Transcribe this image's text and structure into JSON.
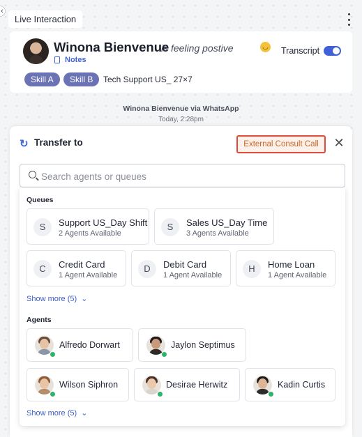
{
  "header": {
    "tab_label": "Live Interaction"
  },
  "customer": {
    "name": "Winona Bienvenue",
    "sentiment": "is feeling postive",
    "notes_label": "Notes",
    "transcript_label": "Transcript",
    "transcript_on": true,
    "skills": [
      "Skill A",
      "Skill B"
    ],
    "queue_info": "Tech Support US_ 27×7"
  },
  "conversation": {
    "source": "Winona Bienvenue via WhatsApp",
    "time": "Today, 2:28pm"
  },
  "transfer": {
    "title": "Transfer to",
    "external_consult_label": "External Consult Call",
    "search_placeholder": "Search agents or queues",
    "queues_label": "Queues",
    "queues": [
      {
        "letter": "S",
        "name": "Support US_Day Shift",
        "availability": "2 Agents Available"
      },
      {
        "letter": "S",
        "name": "Sales US_Day Time",
        "availability": "3 Agents Available"
      },
      {
        "letter": "C",
        "name": "Credit Card",
        "availability": "1 Agent Available"
      },
      {
        "letter": "D",
        "name": "Debit Card",
        "availability": "1 Agent Available"
      },
      {
        "letter": "H",
        "name": "Home Loan",
        "availability": "1 Agent Available"
      }
    ],
    "queues_show_more": "Show more (5)",
    "agents_label": "Agents",
    "agents": [
      {
        "name": "Alfredo Dorwart",
        "status": "online"
      },
      {
        "name": "Jaylon Septimus",
        "status": "online"
      },
      {
        "name": "Wilson Siphron",
        "status": "online"
      },
      {
        "name": "Desirae Herwitz",
        "status": "online"
      },
      {
        "name": "Kadin Curtis",
        "status": "online"
      }
    ],
    "agents_show_more": "Show more (5)"
  },
  "colors": {
    "accent": "#4062d6",
    "skill_pill": "#6c73b5",
    "consult_border": "#e04a3f",
    "consult_text": "#c8662a",
    "online": "#2fb36a"
  }
}
